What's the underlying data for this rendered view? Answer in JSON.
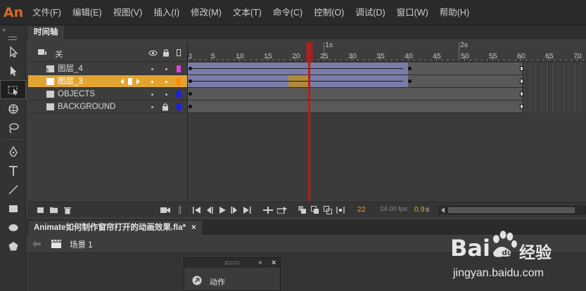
{
  "app": {
    "logo": "An"
  },
  "menu": [
    "文件(F)",
    "编辑(E)",
    "视图(V)",
    "插入(I)",
    "修改(M)",
    "文本(T)",
    "命令(C)",
    "控制(O)",
    "调试(D)",
    "窗口(W)",
    "帮助(H)"
  ],
  "timeline": {
    "tab_label": "时间轴",
    "header_label": "关",
    "layers": [
      {
        "name": "图层_4",
        "color": "#e040e0",
        "selected": false,
        "locked": false
      },
      {
        "name": "图层_3",
        "color": "#ff8a00",
        "selected": true,
        "locked": false
      },
      {
        "name": "OBJECTS",
        "color": "#1a1aff",
        "selected": false,
        "locked": false
      },
      {
        "name": "BACKGROUND",
        "color": "#1a1aff",
        "selected": false,
        "locked": true
      }
    ],
    "ruler_ticks": [
      "1",
      "5",
      "10",
      "15",
      "20",
      "25",
      "30",
      "35",
      "40",
      "45",
      "50",
      "55",
      "60",
      "65",
      "70"
    ],
    "second_marks": [
      "1s",
      "2s"
    ],
    "current_frame": "22",
    "fps": "24.00 fps",
    "time": "0.9",
    "time_unit": "s"
  },
  "document": {
    "tab_label": "Animate如何制作窗帘打开的动画效果.fla*",
    "close_glyph": "×",
    "scene_label": "场景 1"
  },
  "float_panel": {
    "label": "动作",
    "collapse_glyph": "»",
    "close_glyph": "×"
  },
  "watermark": {
    "brand": "Bai",
    "brand2": "经验",
    "url": "jingyan.baidu.com"
  }
}
